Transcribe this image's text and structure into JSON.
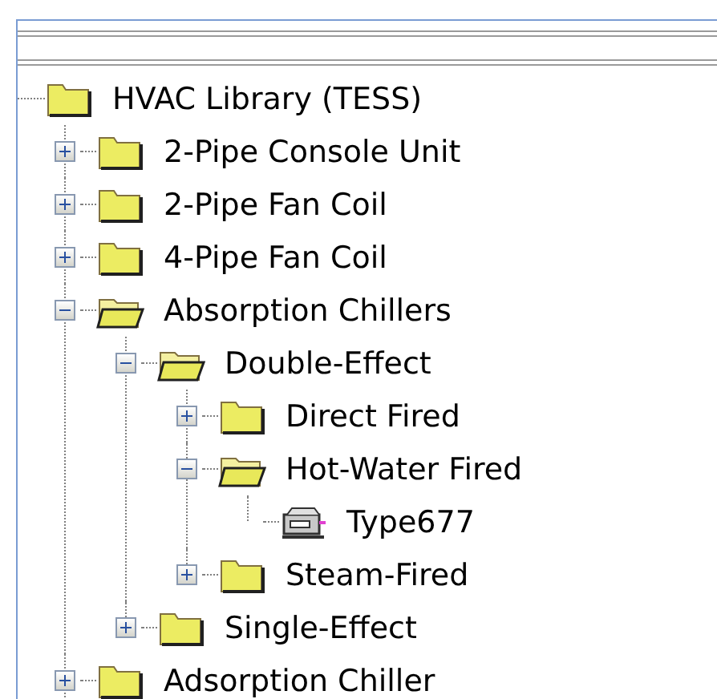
{
  "tree": [
    {
      "label": "HVAC Library (TESS)",
      "kind": "root",
      "children": [
        {
          "label": "2-Pipe Console Unit",
          "kind": "folder",
          "expanded": false
        },
        {
          "label": "2-Pipe Fan Coil",
          "kind": "folder",
          "expanded": false
        },
        {
          "label": "4-Pipe Fan Coil",
          "kind": "folder",
          "expanded": false
        },
        {
          "label": "Absorption Chillers",
          "kind": "folder",
          "expanded": true,
          "children": [
            {
              "label": "Double-Effect",
              "kind": "folder",
              "expanded": true,
              "children": [
                {
                  "label": "Direct Fired",
                  "kind": "folder",
                  "expanded": false
                },
                {
                  "label": "Hot-Water Fired",
                  "kind": "folder",
                  "expanded": true,
                  "children": [
                    {
                      "label": "Type677",
                      "kind": "component"
                    }
                  ]
                },
                {
                  "label": "Steam-Fired",
                  "kind": "folder",
                  "expanded": false
                }
              ]
            },
            {
              "label": "Single-Effect",
              "kind": "folder",
              "expanded": false
            }
          ]
        },
        {
          "label": "Adsorption Chiller",
          "kind": "folder",
          "expanded": false
        }
      ]
    }
  ]
}
